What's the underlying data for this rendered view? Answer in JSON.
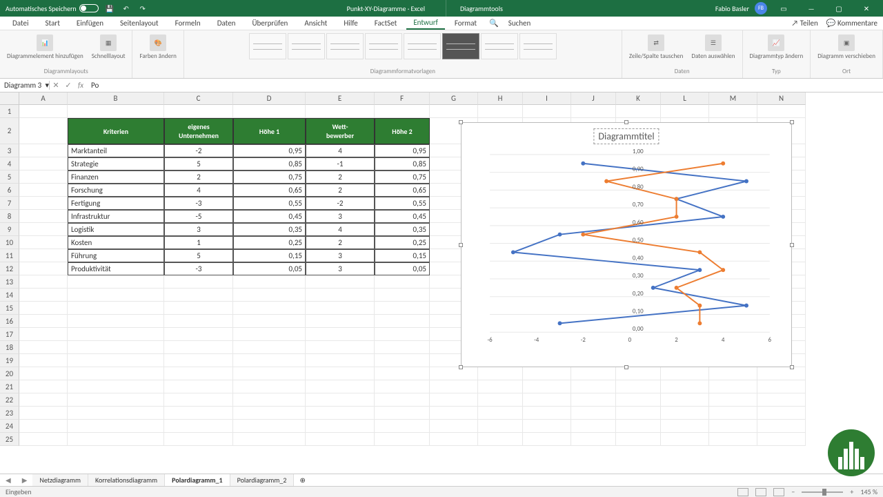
{
  "titlebar": {
    "autosave_label": "Automatisches Speichern",
    "doc_name": "Punkt-XY-Diagramme",
    "app_name": "Excel",
    "tool_context": "Diagrammtools",
    "user_name": "Fabio Basler",
    "user_initials": "FB"
  },
  "tabs": {
    "file": "Datei",
    "items": [
      "Start",
      "Einfügen",
      "Seitenlayout",
      "Formeln",
      "Daten",
      "Überprüfen",
      "Ansicht",
      "Hilfe",
      "FactSet",
      "Entwurf",
      "Format"
    ],
    "active": "Entwurf",
    "search": "Suchen",
    "share": "Teilen",
    "comments": "Kommentare"
  },
  "ribbon": {
    "groups": {
      "layouts": {
        "label": "Diagrammlayouts",
        "btn1": "Diagrammelement hinzufügen",
        "btn2": "Schnelllayout",
        "btn3": "Farben ändern"
      },
      "styles_label": "Diagrammformatvorlagen",
      "data": {
        "label": "Daten",
        "btn1": "Zeile/Spalte tauschen",
        "btn2": "Daten auswählen"
      },
      "type": {
        "label": "Typ",
        "btn1": "Diagrammtyp ändern"
      },
      "location": {
        "label": "Ort",
        "btn1": "Diagramm verschieben"
      }
    }
  },
  "formula_bar": {
    "name_box": "Diagramm 3",
    "formula": "Po"
  },
  "columns": [
    "A",
    "B",
    "C",
    "D",
    "E",
    "F",
    "G",
    "H",
    "I",
    "J",
    "K",
    "L",
    "M",
    "N"
  ],
  "table": {
    "headers": [
      "Kriterien",
      "eigenes Unternehmen",
      "Höhe 1",
      "Wett-bewerber",
      "Höhe 2"
    ],
    "rows": [
      [
        "Marktanteil",
        "-2",
        "0,95",
        "4",
        "0,95"
      ],
      [
        "Strategie",
        "5",
        "0,85",
        "-1",
        "0,85"
      ],
      [
        "Finanzen",
        "2",
        "0,75",
        "2",
        "0,75"
      ],
      [
        "Forschung",
        "4",
        "0,65",
        "2",
        "0,65"
      ],
      [
        "Fertigung",
        "-3",
        "0,55",
        "-2",
        "0,55"
      ],
      [
        "Infrastruktur",
        "-5",
        "0,45",
        "3",
        "0,45"
      ],
      [
        "Logistik",
        "3",
        "0,35",
        "4",
        "0,35"
      ],
      [
        "Kosten",
        "1",
        "0,25",
        "2",
        "0,25"
      ],
      [
        "Führung",
        "5",
        "0,15",
        "3",
        "0,15"
      ],
      [
        "Produktivität",
        "-3",
        "0,05",
        "3",
        "0,05"
      ]
    ]
  },
  "chart_data": {
    "type": "scatter",
    "title": "Diagrammtitel",
    "xlim": [
      -6,
      6
    ],
    "ylim": [
      0,
      1.0
    ],
    "x_ticks": [
      -6,
      -4,
      -2,
      0,
      2,
      4,
      6
    ],
    "y_ticks": [
      "0,00",
      "0,10",
      "0,20",
      "0,30",
      "0,40",
      "0,50",
      "0,60",
      "0,70",
      "0,80",
      "0,90",
      "1,00"
    ],
    "series": [
      {
        "name": "eigenes Unternehmen",
        "color": "#4472C4",
        "points": [
          [
            -2,
            0.95
          ],
          [
            5,
            0.85
          ],
          [
            2,
            0.75
          ],
          [
            4,
            0.65
          ],
          [
            -3,
            0.55
          ],
          [
            -5,
            0.45
          ],
          [
            3,
            0.35
          ],
          [
            1,
            0.25
          ],
          [
            5,
            0.15
          ],
          [
            -3,
            0.05
          ]
        ]
      },
      {
        "name": "Wettbewerber",
        "color": "#ED7D31",
        "points": [
          [
            4,
            0.95
          ],
          [
            -1,
            0.85
          ],
          [
            2,
            0.75
          ],
          [
            2,
            0.65
          ],
          [
            -2,
            0.55
          ],
          [
            3,
            0.45
          ],
          [
            4,
            0.35
          ],
          [
            2,
            0.25
          ],
          [
            3,
            0.15
          ],
          [
            3,
            0.05
          ]
        ]
      }
    ]
  },
  "sheets": {
    "tabs": [
      "Netzdiagramm",
      "Korrelationsdiagramm",
      "Polardiagramm_1",
      "Polardiagramm_2"
    ],
    "active_index": 2
  },
  "status_bar": {
    "left": "Eingeben",
    "zoom": "145 %"
  }
}
